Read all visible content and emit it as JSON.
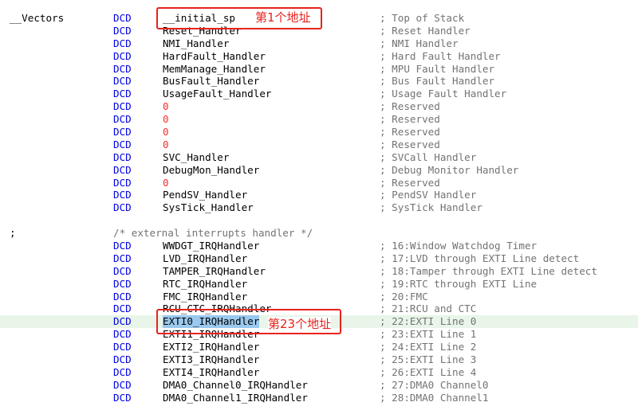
{
  "lines": [
    {
      "label": "__Vectors",
      "dir": "DCD",
      "arg": "__initial_sp",
      "cmt": "; Top of Stack"
    },
    {
      "label": "",
      "dir": "DCD",
      "arg": "Reset_Handler",
      "cmt": "; Reset Handler"
    },
    {
      "label": "",
      "dir": "DCD",
      "arg": "NMI_Handler",
      "cmt": "; NMI Handler"
    },
    {
      "label": "",
      "dir": "DCD",
      "arg": "HardFault_Handler",
      "cmt": "; Hard Fault Handler"
    },
    {
      "label": "",
      "dir": "DCD",
      "arg": "MemManage_Handler",
      "cmt": "; MPU Fault Handler"
    },
    {
      "label": "",
      "dir": "DCD",
      "arg": "BusFault_Handler",
      "cmt": "; Bus Fault Handler"
    },
    {
      "label": "",
      "dir": "DCD",
      "arg": "UsageFault_Handler",
      "cmt": "; Usage Fault Handler"
    },
    {
      "label": "",
      "dir": "DCD",
      "arg": "0",
      "cmt": "; Reserved"
    },
    {
      "label": "",
      "dir": "DCD",
      "arg": "0",
      "cmt": "; Reserved"
    },
    {
      "label": "",
      "dir": "DCD",
      "arg": "0",
      "cmt": "; Reserved"
    },
    {
      "label": "",
      "dir": "DCD",
      "arg": "0",
      "cmt": "; Reserved"
    },
    {
      "label": "",
      "dir": "DCD",
      "arg": "SVC_Handler",
      "cmt": "; SVCall Handler"
    },
    {
      "label": "",
      "dir": "DCD",
      "arg": "DebugMon_Handler",
      "cmt": "; Debug Monitor Handler"
    },
    {
      "label": "",
      "dir": "DCD",
      "arg": "0",
      "cmt": "; Reserved"
    },
    {
      "label": "",
      "dir": "DCD",
      "arg": "PendSV_Handler",
      "cmt": "; PendSV Handler"
    },
    {
      "label": "",
      "dir": "DCD",
      "arg": "SysTick_Handler",
      "cmt": "; SysTick Handler"
    },
    {
      "label": "",
      "dir": "",
      "arg": "",
      "cmt": ""
    },
    {
      "label": ";",
      "block": "/* external interrupts handler */"
    },
    {
      "label": "",
      "dir": "DCD",
      "arg": "WWDGT_IRQHandler",
      "cmt": "; 16:Window Watchdog Timer"
    },
    {
      "label": "",
      "dir": "DCD",
      "arg": "LVD_IRQHandler",
      "cmt": "; 17:LVD through EXTI Line detect"
    },
    {
      "label": "",
      "dir": "DCD",
      "arg": "TAMPER_IRQHandler",
      "cmt": "; 18:Tamper through EXTI Line detect"
    },
    {
      "label": "",
      "dir": "DCD",
      "arg": "RTC_IRQHandler",
      "cmt": "; 19:RTC through EXTI Line"
    },
    {
      "label": "",
      "dir": "DCD",
      "arg": "FMC_IRQHandler",
      "cmt": "; 20:FMC"
    },
    {
      "label": "",
      "dir": "DCD",
      "arg": "RCU_CTC_IRQHandler",
      "cmt": "; 21:RCU and CTC"
    },
    {
      "label": "",
      "dir": "DCD",
      "arg": "EXTI0_IRQHandler",
      "cmt": "; 22:EXTI Line 0"
    },
    {
      "label": "",
      "dir": "DCD",
      "arg": "EXTI1_IRQHandler",
      "cmt": "; 23:EXTI Line 1"
    },
    {
      "label": "",
      "dir": "DCD",
      "arg": "EXTI2_IRQHandler",
      "cmt": "; 24:EXTI Line 2"
    },
    {
      "label": "",
      "dir": "DCD",
      "arg": "EXTI3_IRQHandler",
      "cmt": "; 25:EXTI Line 3"
    },
    {
      "label": "",
      "dir": "DCD",
      "arg": "EXTI4_IRQHandler",
      "cmt": "; 26:EXTI Line 4"
    },
    {
      "label": "",
      "dir": "DCD",
      "arg": "DMA0_Channel0_IRQHandler",
      "cmt": "; 27:DMA0 Channel0"
    },
    {
      "label": "",
      "dir": "DCD",
      "arg": "DMA0_Channel1_IRQHandler",
      "cmt": "; 28:DMA0 Channel1"
    }
  ],
  "annotations": {
    "first": "第1个地址",
    "twentythird": "第23个地址"
  },
  "colors": {
    "directive": "#0000e6",
    "number": "#ff2a2a",
    "comment": "#737373",
    "annotation": "#e8231d",
    "selection": "#99c9ef",
    "current_line": "#e8f5e8"
  }
}
